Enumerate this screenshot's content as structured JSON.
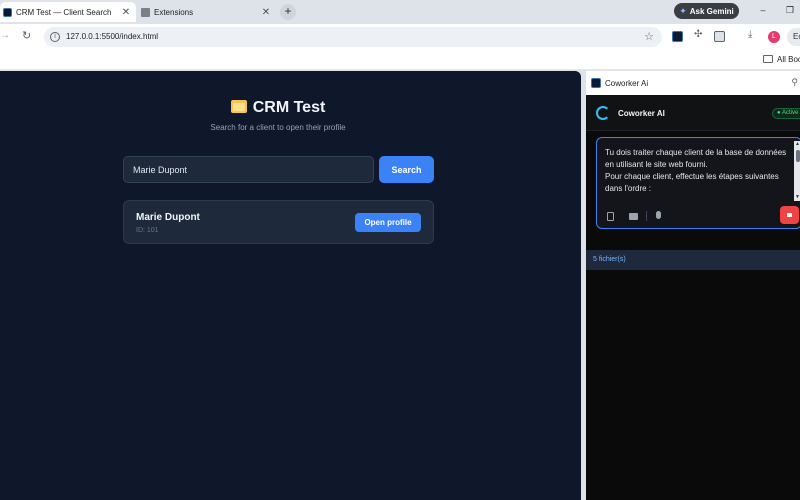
{
  "browser": {
    "tabs": [
      {
        "title": "CRM Test — Client Search",
        "close": "✕"
      },
      {
        "title": "Extensions",
        "close": "✕"
      }
    ],
    "new_tab": "+",
    "ask_gemini": "Ask Gemini",
    "window": {
      "minimize": "–",
      "restore": "❐"
    },
    "url": "127.0.0.1:5500/index.html",
    "avatar_letter": "L",
    "profile_label": "Ec",
    "bookmarks_label": "All Bookmarks"
  },
  "page": {
    "title": "CRM Test",
    "subtitle": "Search for a client to open their profile",
    "search": {
      "value": "Marie Dupont",
      "button": "Search"
    },
    "results": [
      {
        "name": "Marie Dupont",
        "id": "ID: 101",
        "button": "Open profile"
      }
    ]
  },
  "side_panel": {
    "header_title": "Coworker Ai",
    "app_name": "Coworker AI",
    "status": "● Active",
    "prompt": "Tu dois traiter chaque client de la base de données en utilisant le site web fourni.\nPour chaque client, effectue les étapes suivantes dans l'ordre :",
    "files_label": "5 fichier(s)"
  },
  "colors": {
    "page_bg": "#0f172a",
    "accent": "#3b82f6",
    "stop": "#ef4444",
    "status_green": "#4ade80"
  }
}
